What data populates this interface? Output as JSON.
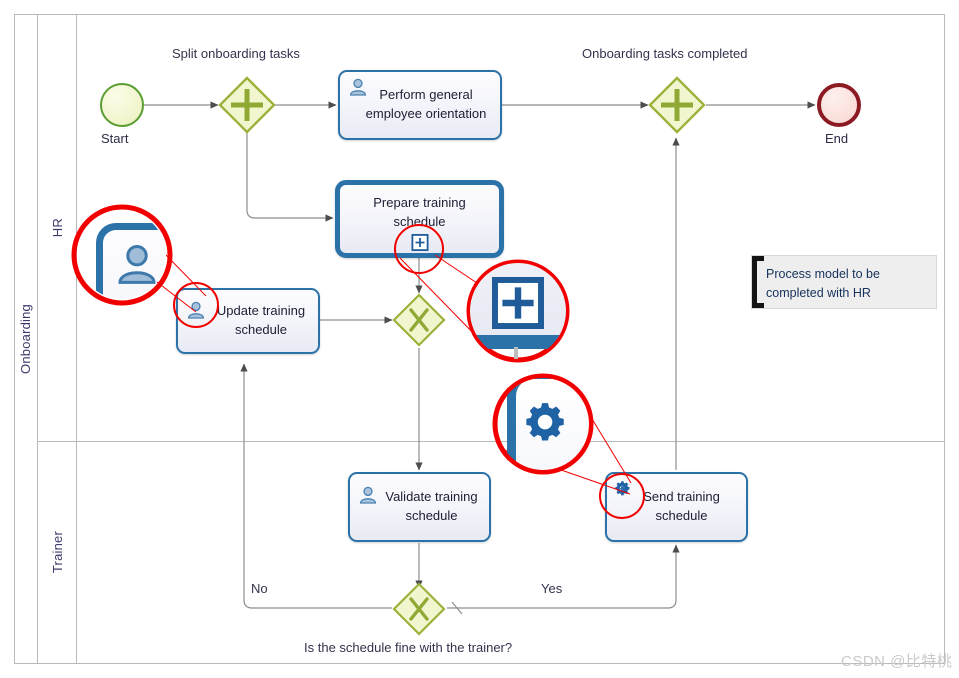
{
  "diagram": {
    "type": "bpmn-process-diagram",
    "pool": {
      "label": "Onboarding"
    },
    "lanes": [
      {
        "id": "hr",
        "label": "HR"
      },
      {
        "id": "trainer",
        "label": "Trainer"
      }
    ],
    "colors": {
      "task_border": "#2b72a8",
      "gateway_fill": "#f2f6cf",
      "gateway_border": "#9bb23b",
      "start_border": "#5a9d32",
      "end_border": "#8c1a23",
      "callout": "#f20000",
      "annotation_text": "#16325c",
      "lane_border": "#b9b9b9"
    },
    "events": [
      {
        "id": "start",
        "label": "Start",
        "kind": "start-event",
        "lane": "hr"
      },
      {
        "id": "end",
        "label": "End",
        "kind": "end-event",
        "lane": "hr"
      }
    ],
    "gateways": [
      {
        "id": "gw-split",
        "label": "Split onboarding tasks",
        "kind": "parallel-gateway",
        "marker": "+",
        "lane": "hr"
      },
      {
        "id": "gw-join",
        "label": "Onboarding tasks completed",
        "kind": "parallel-gateway",
        "marker": "+",
        "lane": "hr"
      },
      {
        "id": "gw-merge-training",
        "label": "",
        "kind": "exclusive-gateway",
        "marker": "X",
        "lane": "hr"
      },
      {
        "id": "gw-schedule-ok",
        "label": "Is the schedule fine with the trainer?",
        "kind": "exclusive-gateway",
        "marker": "X",
        "lane": "trainer"
      }
    ],
    "tasks": [
      {
        "id": "perform-orientation",
        "label": "Perform general employee orientation",
        "icon": "user-icon",
        "task_type": "manual",
        "lane": "hr",
        "is_subprocess": false
      },
      {
        "id": "prepare-schedule",
        "label": "Prepare training schedule",
        "icon": "",
        "task_type": "collapsed-subprocess",
        "lane": "hr",
        "is_subprocess": true,
        "marker": "+"
      },
      {
        "id": "update-schedule",
        "label": "Update training schedule",
        "icon": "user-icon",
        "task_type": "manual",
        "lane": "hr",
        "is_subprocess": false
      },
      {
        "id": "validate-schedule",
        "label": "Validate training schedule",
        "icon": "user-icon",
        "task_type": "manual",
        "lane": "trainer",
        "is_subprocess": false
      },
      {
        "id": "send-schedule",
        "label": "Send training schedule",
        "icon": "gears-icon",
        "task_type": "service",
        "lane": "trainer",
        "is_subprocess": false
      }
    ],
    "flow_labels": [
      {
        "id": "flow-no",
        "label": "No"
      },
      {
        "id": "flow-yes",
        "label": "Yes"
      }
    ],
    "annotations": [
      {
        "id": "hr-note",
        "label": "Process model to be completed with HR"
      }
    ],
    "callouts": [
      {
        "id": "callout-user-icon",
        "target": "user-icon",
        "description": "magnified manual-task user icon"
      },
      {
        "id": "callout-subprocess-marker",
        "target": "plus-marker-icon",
        "description": "magnified collapsed sub-process plus marker"
      },
      {
        "id": "callout-gears-icon",
        "target": "gears-icon",
        "description": "magnified service-task gears icon"
      }
    ],
    "watermark": {
      "label": "CSDN @比特桃"
    }
  }
}
